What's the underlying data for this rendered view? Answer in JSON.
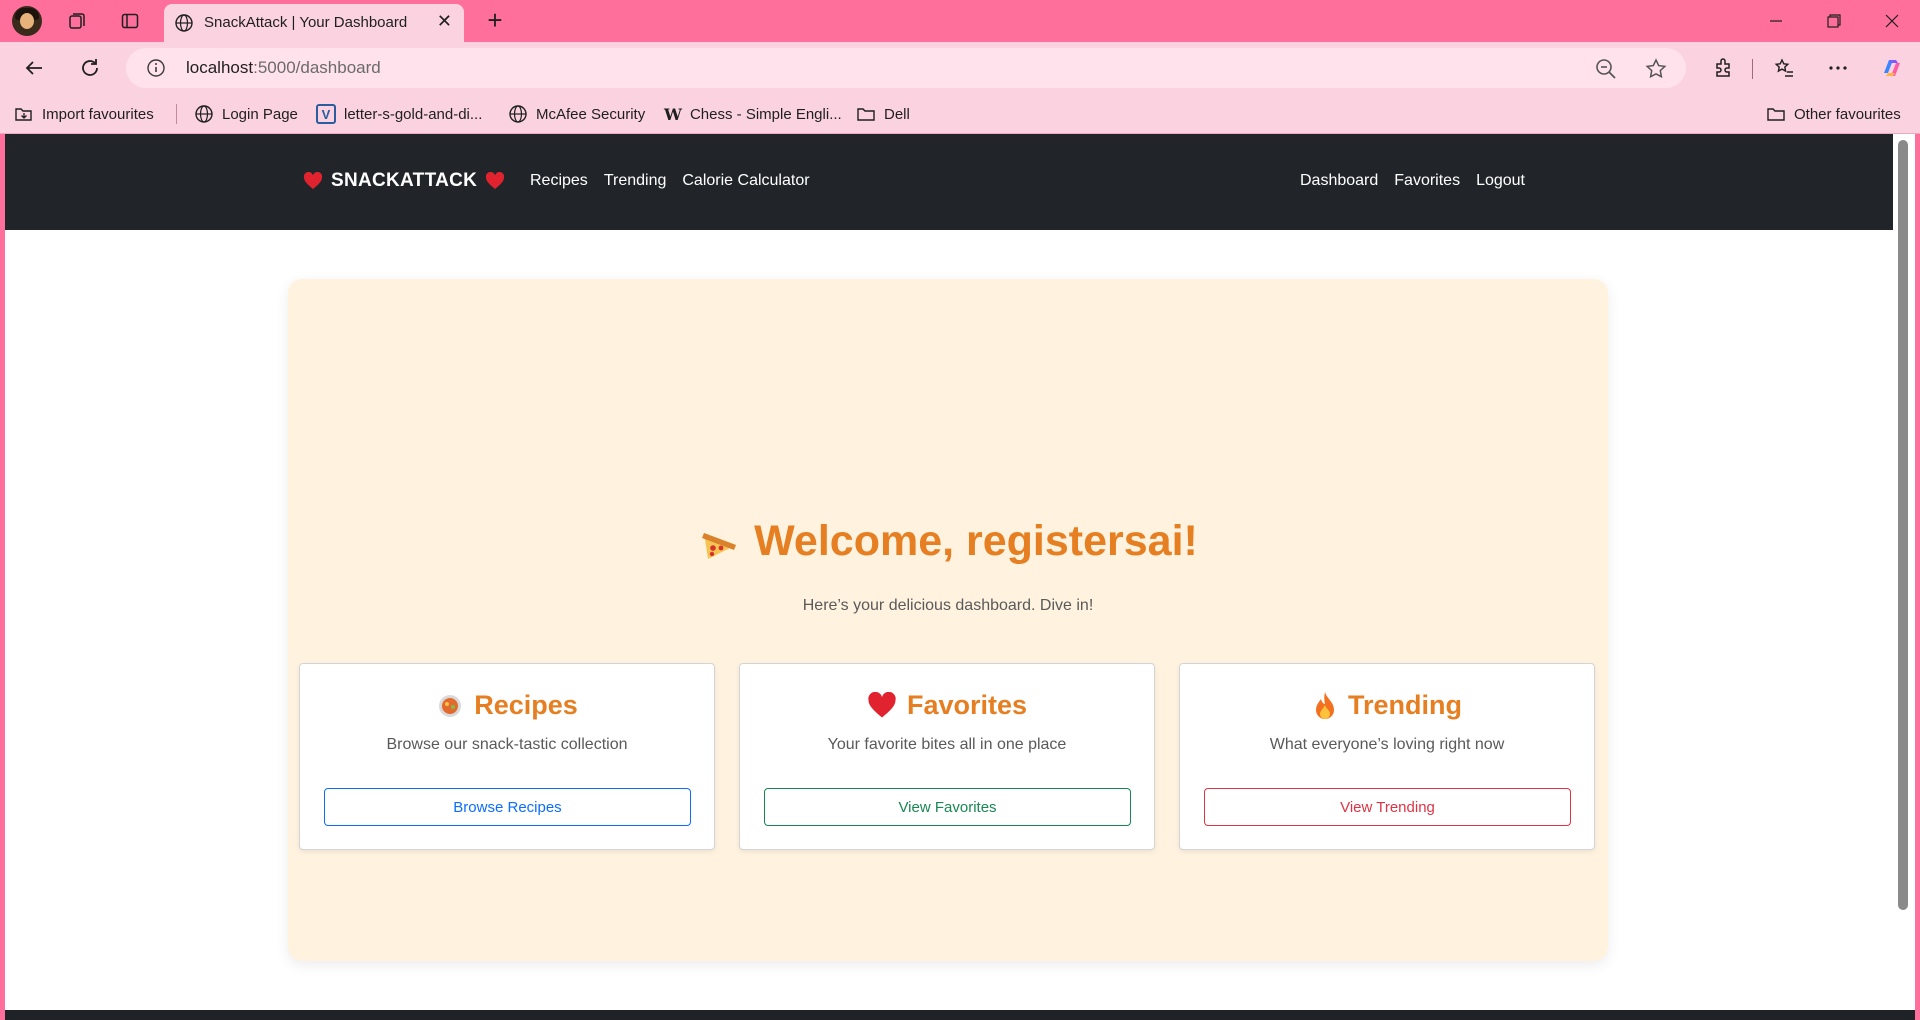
{
  "browser": {
    "tab_title": "SnackAttack | Your Dashboard",
    "url_host": "localhost",
    "url_path": ":5000/dashboard",
    "bookmarks": [
      "Import favourites",
      "Login Page",
      "letter-s-gold-and-di...",
      "McAfee Security",
      "Chess - Simple Engli...",
      "Dell"
    ],
    "other_favourites": "Other favourites"
  },
  "site": {
    "brand": "SNACKATTACK",
    "nav_left": [
      "Recipes",
      "Trending",
      "Calorie Calculator"
    ],
    "nav_right": [
      "Dashboard",
      "Favorites",
      "Logout"
    ]
  },
  "hero": {
    "welcome": "Welcome, registersai!",
    "subtitle": "Here’s your delicious dashboard. Dive in!"
  },
  "cards": [
    {
      "title": "Recipes",
      "desc": "Browse our snack-tastic collection",
      "button": "Browse Recipes",
      "icon": "soup-bowl-icon"
    },
    {
      "title": "Favorites",
      "desc": "Your favorite bites all in one place",
      "button": "View Favorites",
      "icon": "heart-icon"
    },
    {
      "title": "Trending",
      "desc": "What everyone’s loving right now",
      "button": "View Trending",
      "icon": "fire-icon"
    }
  ],
  "colors": {
    "chrome": "#ff6f9b",
    "toolbar": "#fbd3e0",
    "site_nav": "#212529",
    "hero_bg": "#fff3e0",
    "accent": "#e67e22",
    "btn_blue": "#0d6efd",
    "btn_green": "#198754",
    "btn_red": "#dc3545"
  }
}
